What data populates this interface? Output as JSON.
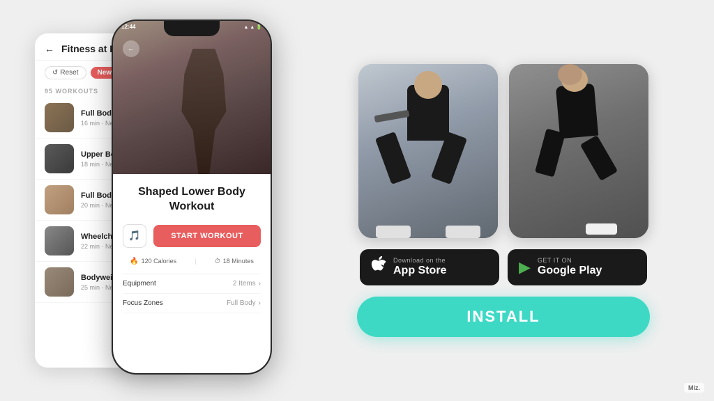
{
  "app": {
    "title": "Fitness at Home",
    "status_time": "12:44",
    "workouts_count": "95 WORKOUTS",
    "filter_reset": "Reset",
    "filter_newbie": "Newbie"
  },
  "workout_items": [
    {
      "name": "Full Body Set",
      "duration": "16 min",
      "level": "Newbie",
      "thumb_class": "thumb-1"
    },
    {
      "name": "Upper Body Exp",
      "duration": "18 min",
      "level": "Newbie",
      "thumb_class": "thumb-2"
    },
    {
      "name": "Full Body Burno",
      "duration": "20 min",
      "level": "Newbie",
      "thumb_class": "thumb-3"
    },
    {
      "name": "Wheelchair Card",
      "duration": "22 min",
      "level": "Newbie",
      "thumb_class": "thumb-4"
    },
    {
      "name": "Bodyweight Wo",
      "duration": "25 min",
      "level": "Newbie",
      "thumb_class": "thumb-5"
    }
  ],
  "featured_workout": {
    "title": "Shaped Lower Body Workout",
    "calories": "120 Calories",
    "minutes": "18 Minutes",
    "equipment_label": "Equipment",
    "equipment_value": "2 Items",
    "focus_label": "Focus Zones",
    "focus_value": "Full Body",
    "start_button": "START WORKOUT"
  },
  "app_store": {
    "subtitle": "Download on the",
    "name": "App Store",
    "icon": "🍎"
  },
  "google_play": {
    "subtitle": "GET IT ON",
    "name": "Google Play",
    "icon": "▶"
  },
  "install_button": "INSTALL",
  "watermark": "Miz."
}
